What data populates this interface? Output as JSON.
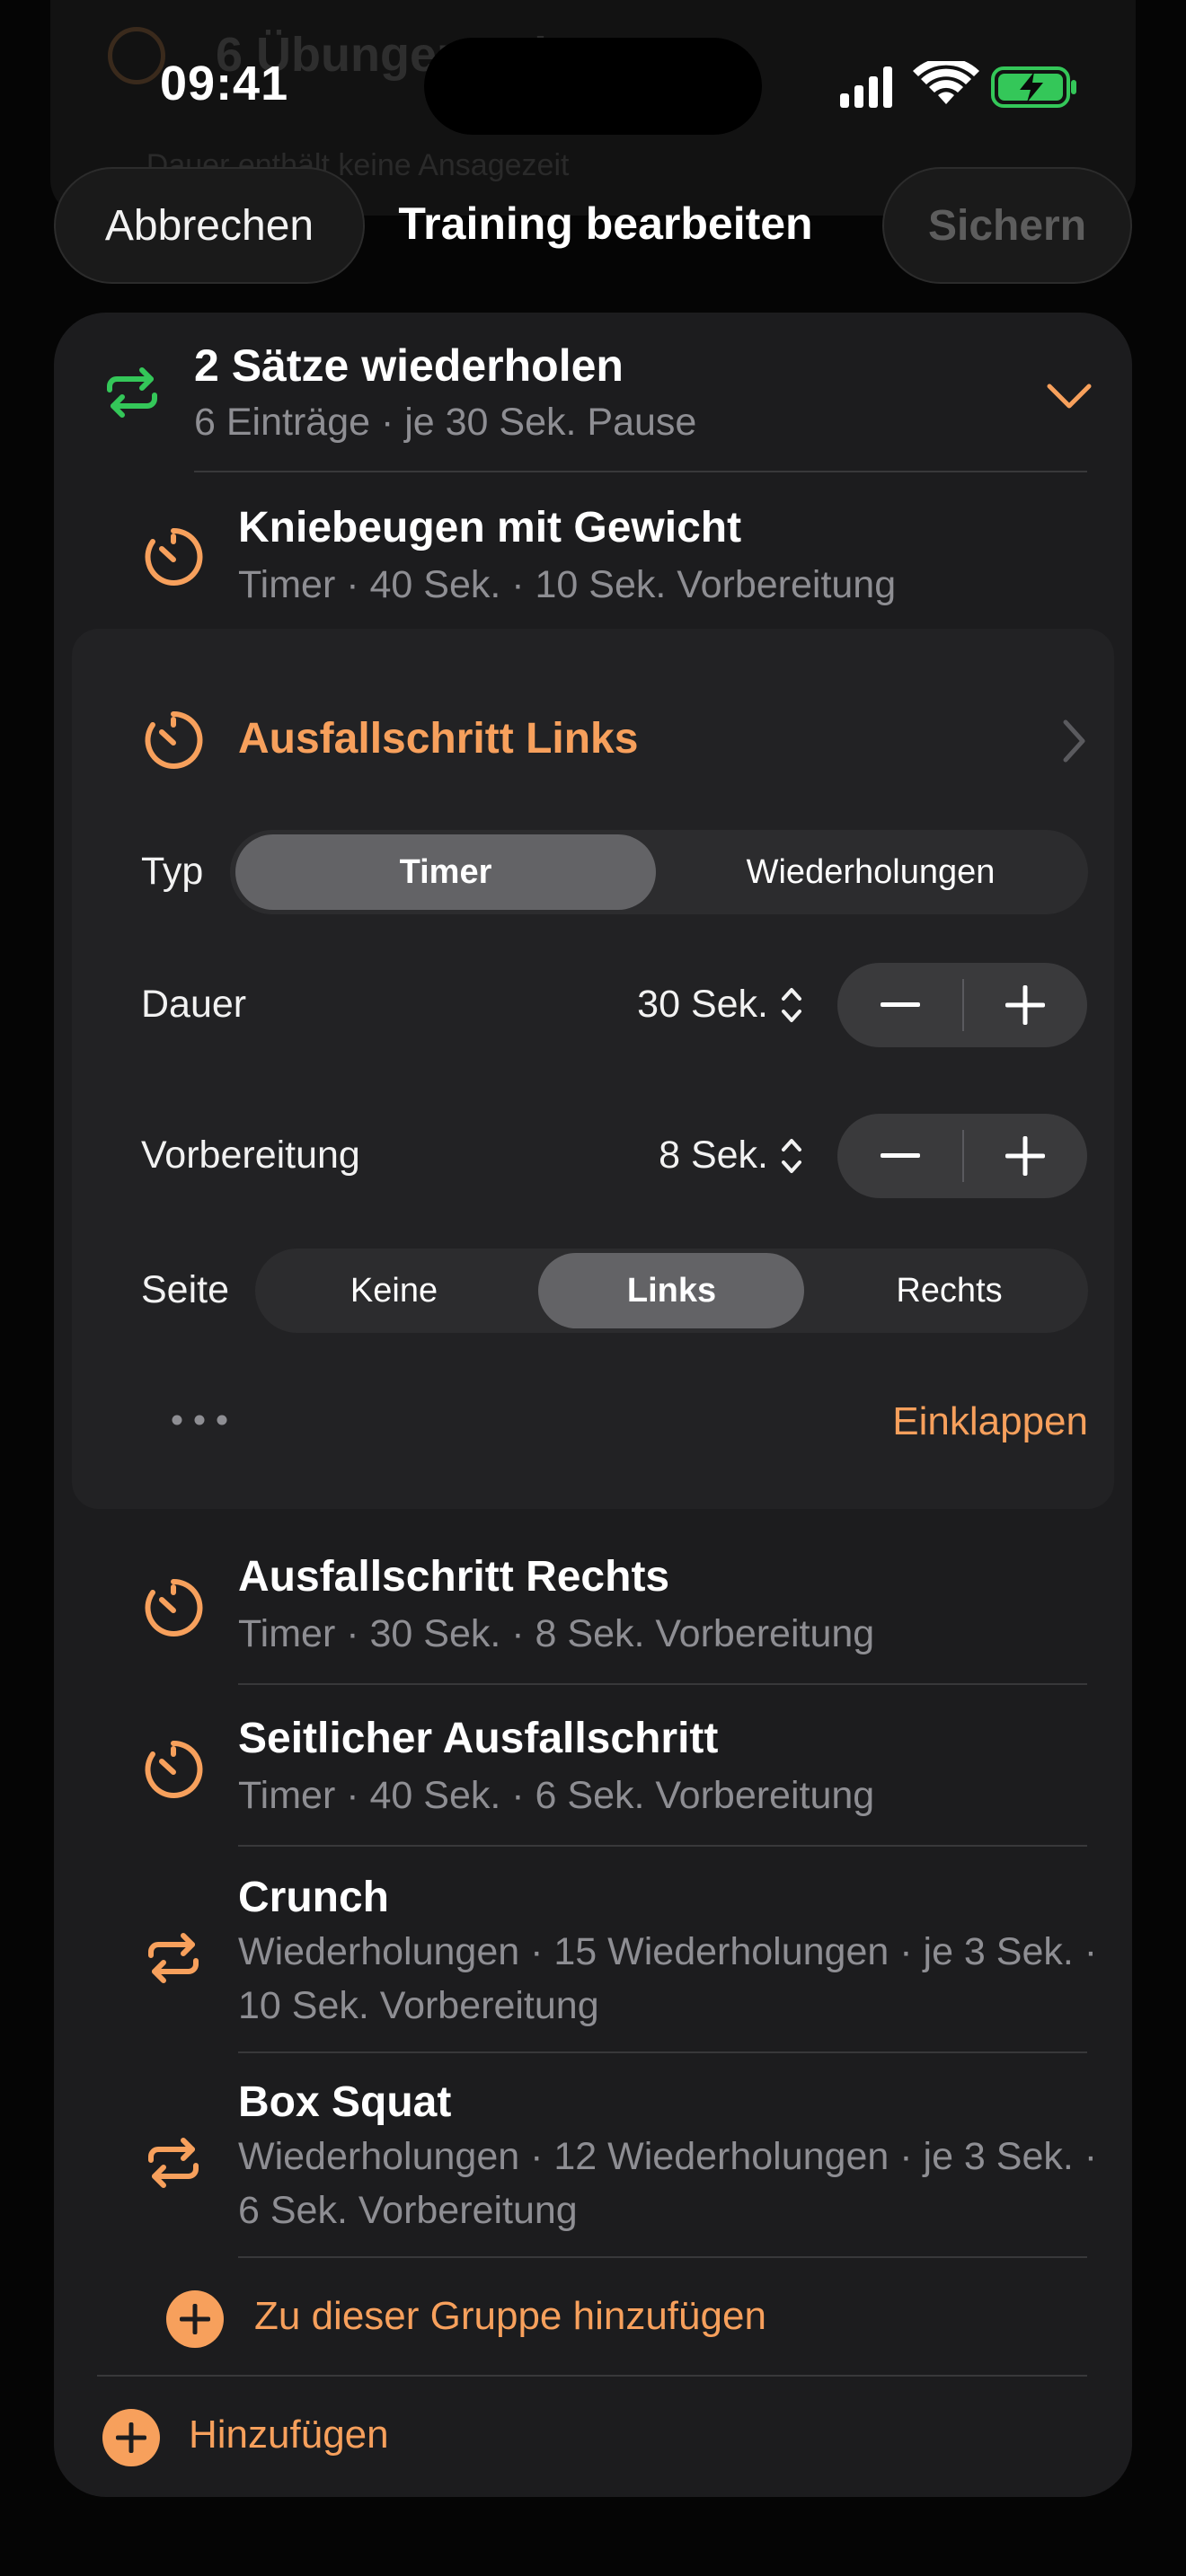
{
  "background": {
    "title": "6 Übungen ... k.",
    "subtitle": "... Dauer enthält keine Ansagezeit"
  },
  "status_bar": {
    "time": "09:41"
  },
  "nav": {
    "cancel": "Abbrechen",
    "title": "Training bearbeiten",
    "save": "Sichern"
  },
  "group": {
    "title": "2 Sätze wiederholen",
    "subtitle": "6 Einträge · je 30 Sek. Pause",
    "icon": "repeat-icon",
    "expanded": true
  },
  "exercises": [
    {
      "title": "Kniebeugen mit Gewicht",
      "subtitle": "Timer · 40 Sek. · 10 Sek. Vorbereitung",
      "icon": "timer-icon"
    }
  ],
  "editor": {
    "title": "Ausfallschritt Links",
    "icon": "timer-icon",
    "type_label": "Typ",
    "type_options": [
      "Timer",
      "Wiederholungen"
    ],
    "type_selected": "Timer",
    "duration_label": "Dauer",
    "duration_value": "30 Sek.",
    "prep_label": "Vorbereitung",
    "prep_value": "8 Sek.",
    "side_label": "Seite",
    "side_options": [
      "Keine",
      "Links",
      "Rechts"
    ],
    "side_selected": "Links",
    "collapse": "Einklappen"
  },
  "more_exercises": [
    {
      "title": "Ausfallschritt Rechts",
      "subtitle": "Timer · 30 Sek. · 8 Sek. Vorbereitung",
      "icon": "timer-icon"
    },
    {
      "title": "Seitlicher Ausfallschritt",
      "subtitle": "Timer · 40 Sek. · 6 Sek. Vorbereitung",
      "icon": "timer-icon"
    },
    {
      "title": "Crunch",
      "subtitle": "Wiederholungen · 15 Wiederholungen · je 3 Sek. · 10 Sek. Vorbereitung",
      "icon": "repeat-icon"
    },
    {
      "title": "Box Squat",
      "subtitle": "Wiederholungen · 12 Wiederholungen · je 3 Sek. · 6 Sek. Vorbereitung",
      "icon": "repeat-icon"
    }
  ],
  "add_to_group": "Zu dieser Gruppe hinzufügen",
  "add": "Hinzufügen",
  "colors": {
    "accent": "#f7a05c",
    "group_icon": "#34c759",
    "card": "#1c1c1e",
    "battery": "#34c759"
  }
}
